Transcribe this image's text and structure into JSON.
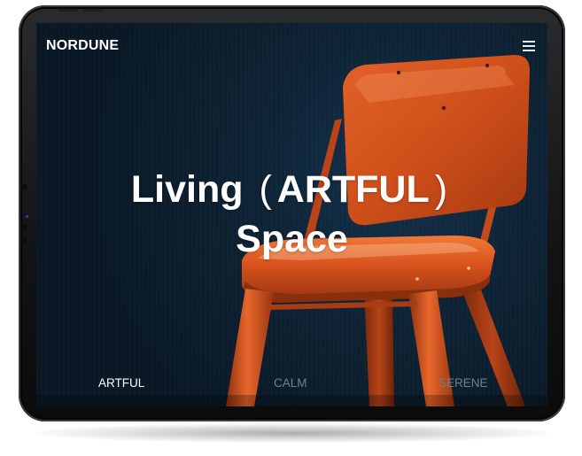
{
  "header": {
    "brand": "NORDUNE",
    "menu_icon": "hamburger-menu-icon"
  },
  "hero": {
    "line1_word": "Living",
    "paren_open": "(",
    "highlight": "ARTFUL",
    "paren_close": ")",
    "line2": "Space"
  },
  "tabs": [
    {
      "label": "ARTFUL",
      "active": true
    },
    {
      "label": "CALM",
      "active": false
    },
    {
      "label": "SERENE",
      "active": false
    }
  ],
  "colors": {
    "background": "#0e2436",
    "chair": "#d9531e",
    "active_tab": "#ffffff",
    "inactive_tab": "#6f7f8e"
  }
}
